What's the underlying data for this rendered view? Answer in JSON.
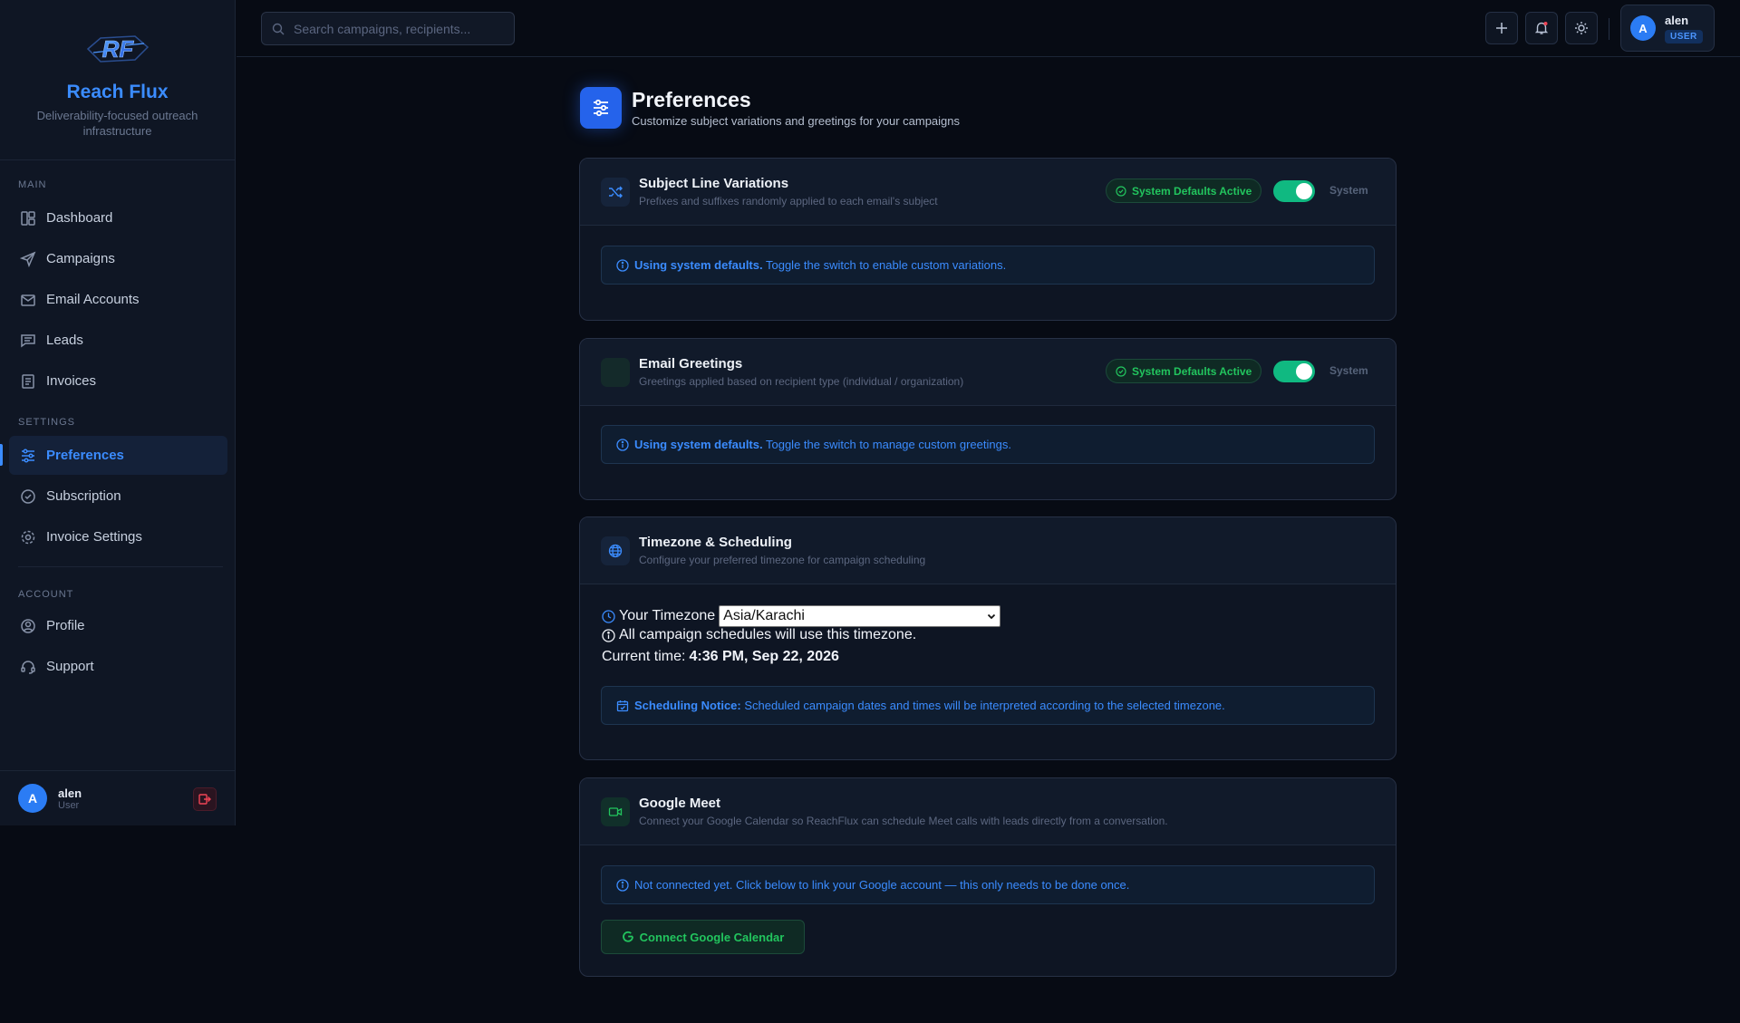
{
  "sidebar": {
    "brand_name": "Reach Flux",
    "brand_tagline": "Deliverability-focused outreach infrastructure",
    "section_main": "MAIN",
    "section_settings": "SETTINGS",
    "section_account": "ACCOUNT",
    "items": {
      "dashboard": "Dashboard",
      "campaigns": "Campaigns",
      "email_accounts": "Email Accounts",
      "leads": "Leads",
      "invoices": "Invoices",
      "preferences": "Preferences",
      "subscription": "Subscription",
      "invoice_settings": "Invoice Settings",
      "profile": "Profile",
      "support": "Support"
    },
    "active_item": "Preferences",
    "user": {
      "initial": "A",
      "name": "alen",
      "role": "User"
    }
  },
  "topbar": {
    "search_placeholder": "Search campaigns, recipients...",
    "user": {
      "initial": "A",
      "name": "alen",
      "role_badge": "USER"
    }
  },
  "page": {
    "title": "Preferences",
    "subtitle": "Customize subject variations and greetings for your campaigns"
  },
  "cards": {
    "subject": {
      "title": "Subject Line Variations",
      "subtitle": "Prefixes and suffixes randomly applied to each email's subject",
      "badge": "System Defaults Active",
      "toggle_on": true,
      "toggle_label": "System",
      "notice_bold": "Using system defaults.",
      "notice_text": " Toggle the switch to enable custom variations."
    },
    "greetings": {
      "title": "Email Greetings",
      "subtitle": "Greetings applied based on recipient type (individual / organization)",
      "badge": "System Defaults Active",
      "toggle_on": true,
      "toggle_label": "System",
      "notice_bold": "Using system defaults.",
      "notice_text": " Toggle the switch to manage custom greetings."
    },
    "timezone": {
      "title": "Timezone & Scheduling",
      "subtitle": "Configure your preferred timezone for campaign scheduling",
      "label": "Your Timezone",
      "selected": "Asia/Karachi",
      "info": "All campaign schedules will use this timezone.",
      "current_label": "Current time:",
      "current_value": "4:36 PM, Sep 22, 2026",
      "notice_bold": "Scheduling Notice:",
      "notice_text": " Scheduled campaign dates and times will be interpreted according to the selected timezone."
    },
    "meet": {
      "title": "Google Meet",
      "subtitle": "Connect your Google Calendar so ReachFlux can schedule Meet calls with leads directly from a conversation.",
      "notice_text": "Not connected yet. Click below to link your Google account — this only needs to be done once.",
      "button_label": "Connect Google Calendar"
    }
  },
  "colors": {
    "accent": "#3b8cff",
    "success": "#22c55e",
    "danger": "#ef4455",
    "background": "#070b14"
  }
}
